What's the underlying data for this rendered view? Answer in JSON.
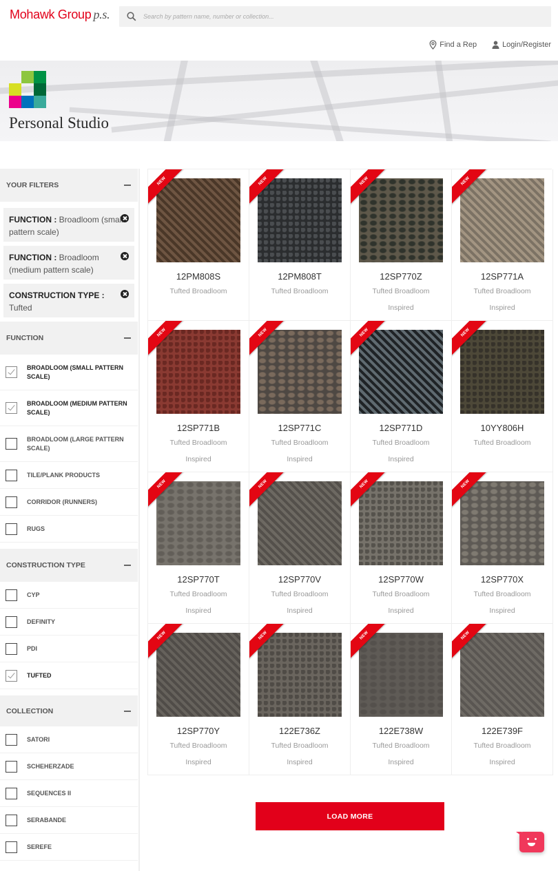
{
  "header": {
    "brand": "Mohawk Group",
    "brand_suffix": "p.s.",
    "search_placeholder": "Search by pattern name, number or collection...",
    "links": [
      {
        "label": "Find a Rep",
        "icon": "map-pin-icon"
      },
      {
        "label": "Login/Register",
        "icon": "user-icon"
      }
    ]
  },
  "banner": {
    "title": "Personal Studio",
    "logo_colors": [
      "#8dc63f",
      "#009245",
      "#d7df23",
      "#006837",
      "#ec008c",
      "#0072bc",
      "#3aaa9b"
    ]
  },
  "sidebar": {
    "your_filters": {
      "title": "YOUR FILTERS",
      "chips": [
        {
          "key": "FUNCTION :",
          "value": "Broadloom (small pattern scale)"
        },
        {
          "key": "FUNCTION :",
          "value": "Broadloom (medium pattern scale)"
        },
        {
          "key": "CONSTRUCTION TYPE :",
          "value": "Tufted"
        }
      ]
    },
    "function": {
      "title": "FUNCTION",
      "items": [
        {
          "label": "BROADLOOM (SMALL PATTERN SCALE)",
          "checked": true
        },
        {
          "label": "BROADLOOM (MEDIUM PATTERN SCALE)",
          "checked": true
        },
        {
          "label": "BROADLOOM (LARGE PATTERN SCALE)",
          "checked": false
        },
        {
          "label": "TILE/PLANK PRODUCTS",
          "checked": false
        },
        {
          "label": "CORRIDOR (RUNNERS)",
          "checked": false
        },
        {
          "label": "RUGS",
          "checked": false
        }
      ]
    },
    "construction_type": {
      "title": "CONSTRUCTION TYPE",
      "items": [
        {
          "label": "CYP",
          "checked": false
        },
        {
          "label": "DEFINITY",
          "checked": false
        },
        {
          "label": "PDI",
          "checked": false
        },
        {
          "label": "TUFTED",
          "checked": true
        }
      ]
    },
    "collection": {
      "title": "COLLECTION",
      "items": [
        {
          "label": "SATORI",
          "checked": false
        },
        {
          "label": "SCHEHERZADE",
          "checked": false
        },
        {
          "label": "SEQUENCES II",
          "checked": false
        },
        {
          "label": "SERABANDE",
          "checked": false
        },
        {
          "label": "SEREFE",
          "checked": false
        }
      ]
    }
  },
  "products": {
    "badge": "NEW",
    "items": [
      {
        "name": "12PM808S",
        "type": "Tufted Broadloom",
        "collection": "",
        "colors": [
          "#6e5542",
          "#4a3728"
        ]
      },
      {
        "name": "12PM808T",
        "type": "Tufted Broadloom",
        "collection": "",
        "colors": [
          "#2b2d2f",
          "#4a4d50"
        ]
      },
      {
        "name": "12SP770Z",
        "type": "Tufted Broadloom",
        "collection": "Inspired",
        "colors": [
          "#5e584a",
          "#2f332c"
        ]
      },
      {
        "name": "12SP771A",
        "type": "Tufted Broadloom",
        "collection": "Inspired",
        "colors": [
          "#a39582",
          "#7c7264"
        ]
      },
      {
        "name": "12SP771B",
        "type": "Tufted Broadloom",
        "collection": "Inspired",
        "colors": [
          "#8a3a32",
          "#6a2822"
        ]
      },
      {
        "name": "12SP771C",
        "type": "Tufted Broadloom",
        "collection": "Inspired",
        "colors": [
          "#4e4843",
          "#7a6a5c"
        ]
      },
      {
        "name": "12SP771D",
        "type": "Tufted Broadloom",
        "collection": "Inspired",
        "colors": [
          "#5f6a70",
          "#1f2326"
        ]
      },
      {
        "name": "10YY806H",
        "type": "Tufted Broadloom",
        "collection": "",
        "colors": [
          "#4d4838",
          "#36322a"
        ]
      },
      {
        "name": "12SP770T",
        "type": "Tufted Broadloom",
        "collection": "Inspired",
        "colors": [
          "#77736c",
          "#625e58"
        ]
      },
      {
        "name": "12SP770V",
        "type": "Tufted Broadloom",
        "collection": "Inspired",
        "colors": [
          "#6d6962",
          "#54504b"
        ]
      },
      {
        "name": "12SP770W",
        "type": "Tufted Broadloom",
        "collection": "Inspired",
        "colors": [
          "#76726a",
          "#55524c"
        ]
      },
      {
        "name": "12SP770X",
        "type": "Tufted Broadloom",
        "collection": "Inspired",
        "colors": [
          "#5e5a55",
          "#7f7a71"
        ]
      },
      {
        "name": "12SP770Y",
        "type": "Tufted Broadloom",
        "collection": "Inspired",
        "colors": [
          "#66625c",
          "#504c48"
        ]
      },
      {
        "name": "122E736Z",
        "type": "Tufted Broadloom",
        "collection": "Inspired",
        "colors": [
          "#6a655e",
          "#4f4b46"
        ]
      },
      {
        "name": "122E738W",
        "type": "Tufted Broadloom",
        "collection": "Inspired",
        "colors": [
          "#5f5b56",
          "#54504c"
        ]
      },
      {
        "name": "122E739F",
        "type": "Tufted Broadloom",
        "collection": "Inspired",
        "colors": [
          "#5a5652",
          "#6e6a64"
        ]
      }
    ]
  },
  "load_more_label": "LOAD MORE",
  "colors": {
    "accent": "#e2001a",
    "chat": "#f0385b"
  }
}
